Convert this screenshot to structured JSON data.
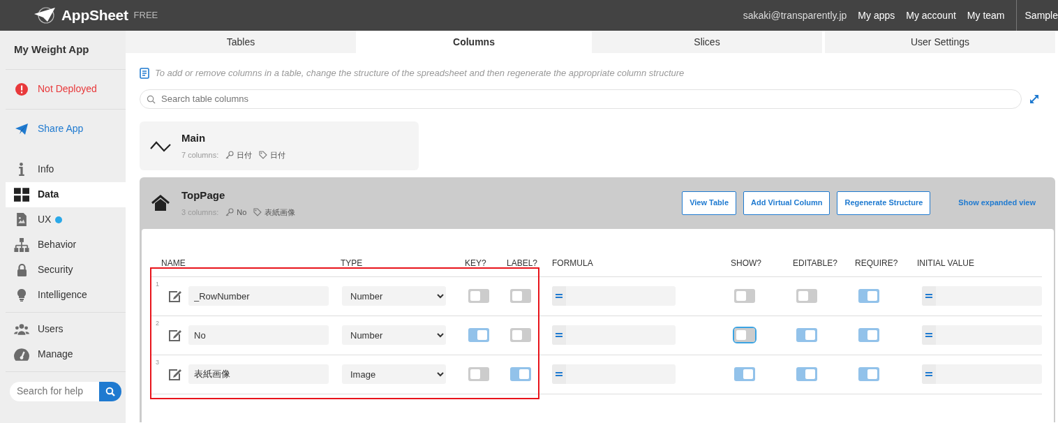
{
  "topbar": {
    "brand": "AppSheet",
    "plan": "FREE",
    "email": "sakaki@transparently.jp",
    "links": [
      "My apps",
      "My account",
      "My team"
    ],
    "cut_link": "Sample"
  },
  "sidebar": {
    "app_name": "My Weight App",
    "status": "Not Deployed",
    "share": "Share App",
    "groups": [
      [
        {
          "label": "Info",
          "selected": false,
          "dot": false
        },
        {
          "label": "Data",
          "selected": true,
          "dot": false
        },
        {
          "label": "UX",
          "selected": false,
          "dot": true
        },
        {
          "label": "Behavior",
          "selected": false,
          "dot": false
        },
        {
          "label": "Security",
          "selected": false,
          "dot": false
        },
        {
          "label": "Intelligence",
          "selected": false,
          "dot": false
        }
      ],
      [
        {
          "label": "Users",
          "selected": false,
          "dot": false
        },
        {
          "label": "Manage",
          "selected": false,
          "dot": false
        }
      ]
    ],
    "help_search": {
      "placeholder": "Search for help"
    }
  },
  "tabs": [
    {
      "label": "Tables",
      "selected": false
    },
    {
      "label": "Columns",
      "selected": true
    },
    {
      "label": "Slices",
      "selected": false
    },
    {
      "label": "User Settings",
      "selected": false
    }
  ],
  "hint": "To add or remove columns in a table, change the structure of the spreadsheet and then regenerate the appropriate column structure",
  "search": {
    "placeholder": "Search table columns"
  },
  "tables": [
    {
      "name": "Main",
      "count": "7 columns:",
      "key": "日付",
      "label": "日付",
      "expanded": false
    },
    {
      "name": "TopPage",
      "count": "3 columns:",
      "key": "No",
      "label": "表紙画像",
      "expanded": true,
      "buttons": [
        "View Table",
        "Add Virtual Column",
        "Regenerate Structure"
      ],
      "link": "Show expanded view",
      "columns": [
        "NAME",
        "TYPE",
        "KEY?",
        "LABEL?",
        "FORMULA",
        "SHOW?",
        "EDITABLE?",
        "REQUIRE?",
        "INITIAL VALUE"
      ],
      "rows": [
        {
          "num": "1",
          "name": "_RowNumber",
          "type": "Number",
          "key": false,
          "label": false,
          "show": false,
          "editable": false,
          "require": true,
          "show_focused": false
        },
        {
          "num": "2",
          "name": "No",
          "type": "Number",
          "key": true,
          "label": false,
          "show": false,
          "editable": true,
          "require": true,
          "show_focused": true
        },
        {
          "num": "3",
          "name": "表紙画像",
          "type": "Image",
          "key": false,
          "label": true,
          "show": true,
          "editable": true,
          "require": true,
          "show_focused": false
        }
      ]
    }
  ]
}
